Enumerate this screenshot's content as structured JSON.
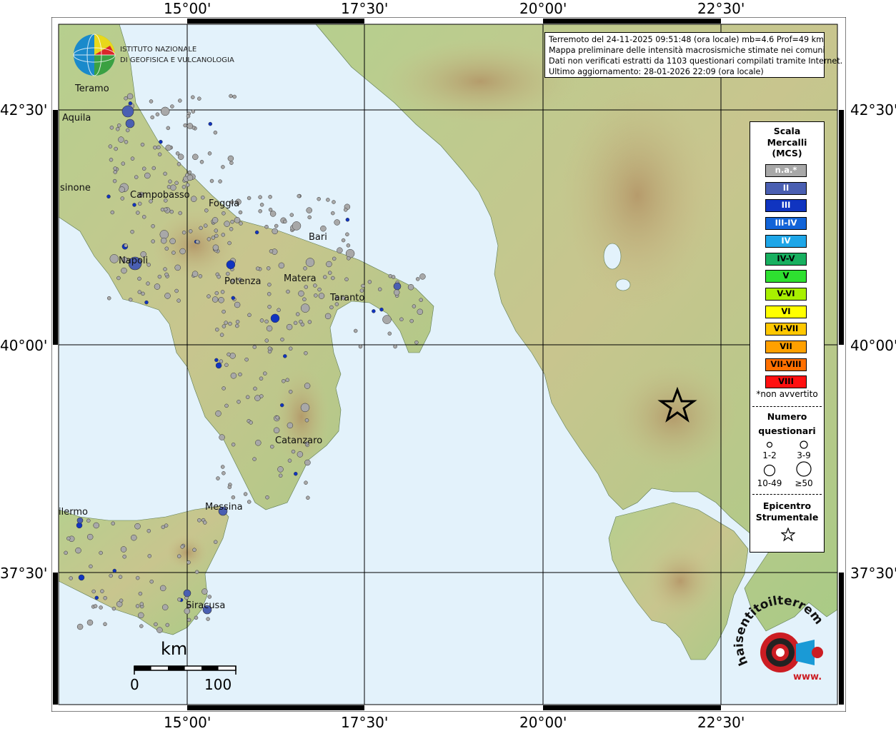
{
  "ticks": {
    "top": [
      "15°00'",
      "17°30'",
      "20°00'",
      "22°30'"
    ],
    "bottom": [
      "15°00'",
      "17°30'",
      "20°00'",
      "22°30'"
    ],
    "left": [
      "42°30'",
      "40°00'",
      "37°30'"
    ],
    "right": [
      "42°30'",
      "40°00'",
      "37°30'"
    ]
  },
  "logo": {
    "line1": "ISTITUTO NAZIONALE",
    "line2": "DI GEOFISICA E VULCANOLOGIA"
  },
  "info": {
    "line1": "Terremoto del 24-11-2025 09:51:48 (ora locale) mb=4.6 Prof=49 km",
    "line2": "Mappa preliminare delle intensità macrosismiche stimate nei comuni",
    "line3": "Dati non verificati estratti da 1103 questionari compilati tramite Internet.",
    "line4": "Ultimo aggiornamento: 28-01-2026 22:09 (ora locale)"
  },
  "cities": {
    "teramo": "Teramo",
    "aquila": "Aquila",
    "frosinone": "sinone",
    "campobasso": "Campobasso",
    "foggia": "Foggia",
    "bari": "Bari",
    "napoli": "Napoli",
    "potenza": "Potenza",
    "matera": "Matera",
    "taranto": "Taranto",
    "catanzaro": "Catanzaro",
    "messina": "Messina",
    "palermo": "ilermo",
    "siracusa": "Siracusa"
  },
  "scalebar": {
    "unit": "km",
    "min": "0",
    "max": "100"
  },
  "legend": {
    "title_lines": [
      "Scala",
      "Mercalli",
      "(MCS)"
    ],
    "classes": [
      {
        "label": "n.a.*",
        "color": "#a8a8a8",
        "text": "#ffffff"
      },
      {
        "label": "II",
        "color": "#4a5fb2",
        "text": "#ffffff"
      },
      {
        "label": "III",
        "color": "#1034c0",
        "text": "#ffffff"
      },
      {
        "label": "III-IV",
        "color": "#1264d8",
        "text": "#ffffff"
      },
      {
        "label": "IV",
        "color": "#1ea6e8",
        "text": "#ffffff"
      },
      {
        "label": "IV-V",
        "color": "#18b060",
        "text": "#000000"
      },
      {
        "label": "V",
        "color": "#2ee030",
        "text": "#000000"
      },
      {
        "label": "V-VI",
        "color": "#a8f000",
        "text": "#000000"
      },
      {
        "label": "VI",
        "color": "#ffff00",
        "text": "#000000"
      },
      {
        "label": "VI-VII",
        "color": "#ffc800",
        "text": "#000000"
      },
      {
        "label": "VII",
        "color": "#ffa000",
        "text": "#000000"
      },
      {
        "label": "VII-VIII",
        "color": "#ff7000",
        "text": "#000000"
      },
      {
        "label": "VIII",
        "color": "#ff1010",
        "text": "#000000"
      }
    ],
    "note": "*non avvertito",
    "count_title_lines": [
      "Numero",
      "questionari"
    ],
    "counts": [
      "1-2",
      "3-9",
      "10-49",
      "≥50"
    ],
    "epicenter_lines": [
      "Epicentro",
      "Strumentale"
    ]
  },
  "badge": {
    "text": "haisentitoilterremoto.it",
    "www": "www."
  },
  "colors": {
    "sea": "#e3f2fb",
    "land_low": "#a9cd8c",
    "land_mid": "#c9c08a",
    "mountain": "#b79a6f",
    "dot_na": "#a8a8a8",
    "dot_ii": "#4a5fb2",
    "dot_iii": "#1034c0"
  }
}
